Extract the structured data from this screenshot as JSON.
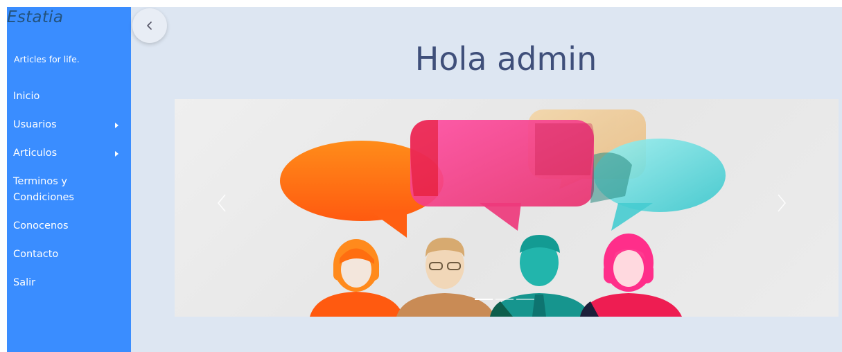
{
  "sidebar": {
    "brand": "Estatia",
    "tagline": "Articles for life.",
    "items": [
      {
        "label": "Inicio",
        "has_submenu": false
      },
      {
        "label": "Usuarios",
        "has_submenu": true
      },
      {
        "label": "Articulos",
        "has_submenu": true
      },
      {
        "label": "Terminos y Condiciones",
        "has_submenu": false
      },
      {
        "label": "Conocenos",
        "has_submenu": false
      },
      {
        "label": "Contacto",
        "has_submenu": false
      },
      {
        "label": "Salir",
        "has_submenu": false
      }
    ]
  },
  "header": {
    "toggle_icon": "chevron-left-icon",
    "greeting": "Hola admin"
  },
  "carousel": {
    "prev_icon": "chevron-left-icon",
    "next_icon": "chevron-right-icon",
    "slide_count": 3,
    "active_slide": 1,
    "image": "people-speech-bubbles-illustration"
  },
  "colors": {
    "sidebar": "#3a8dff",
    "background": "#dde6f2",
    "title": "#3f4f7a",
    "brand": "#23527c"
  }
}
